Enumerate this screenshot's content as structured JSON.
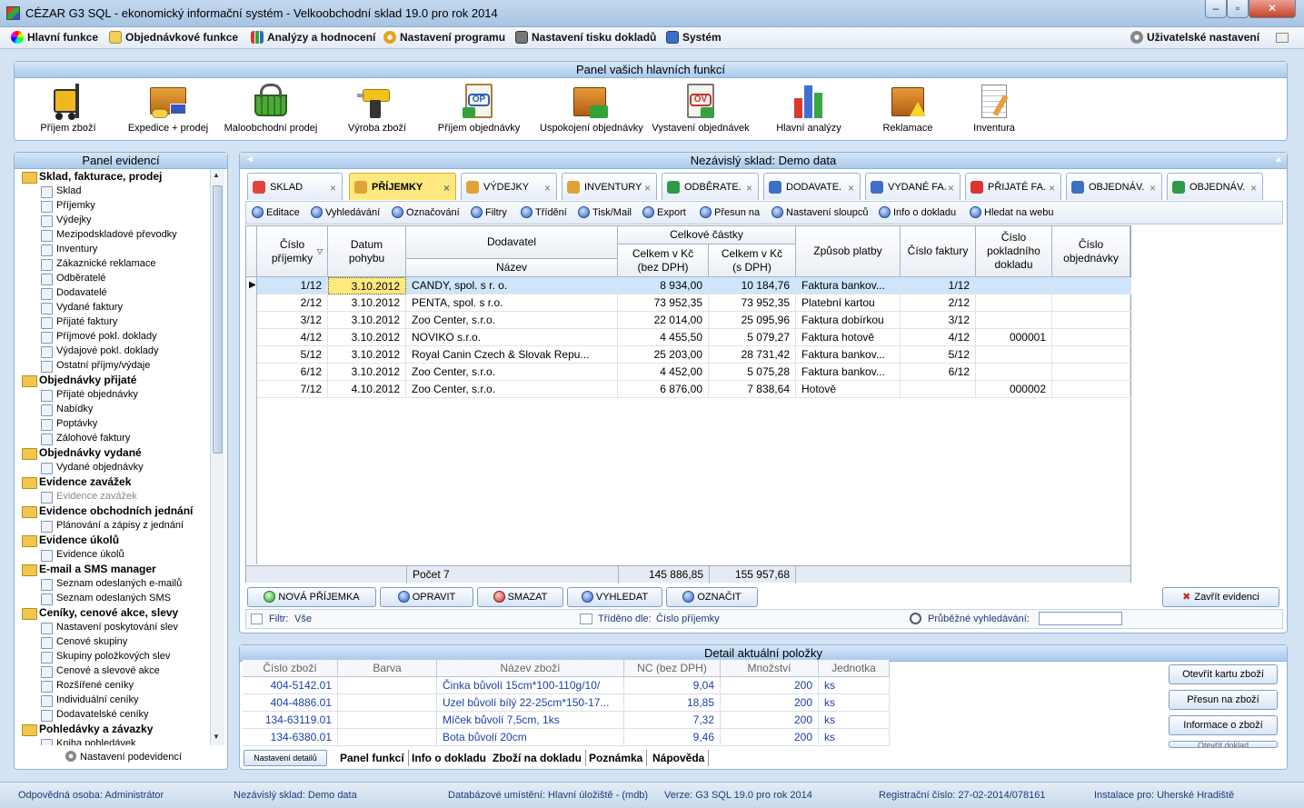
{
  "window": {
    "title": "CÉZAR G3 SQL - ekonomický informační systém - Velkoobchodní sklad 19.0 pro rok 2014",
    "min": "–",
    "max": "▫",
    "close": "✕"
  },
  "menu": {
    "items": [
      "Hlavní funkce",
      "Objednávkové funkce",
      "Analýzy a hodnocení",
      "Nastavení programu",
      "Nastavení tisku dokladů",
      "Systém"
    ],
    "right": "Uživatelské nastavení"
  },
  "main_panel": {
    "title": "Panel vašich hlavních funkcí",
    "functions": [
      "Příjem zboží",
      "Expedice + prodej",
      "Maloobchodní prodej",
      "Výroba zboží",
      "Příjem objednávky",
      "Uspokojení objednávky",
      "Vystavení objednávek",
      "Hlavní analýzy",
      "Reklamace",
      "Inventura"
    ]
  },
  "evid": {
    "title": "Panel evidencí",
    "groups": [
      {
        "label": "Sklad, fakturace, prodej",
        "items": [
          "Sklad",
          "Příjemky",
          "Výdejky",
          "Mezipodskladové převodky",
          "Inventury",
          "Zákaznické reklamace",
          "Odběratelé",
          "Dodavatelé",
          "Vydané faktury",
          "Přijaté faktury",
          "Příjmové pokl. doklady",
          "Výdajové pokl. doklady",
          "Ostatní příjmy/výdaje"
        ]
      },
      {
        "label": "Objednávky přijaté",
        "items": [
          "Přijaté objednávky",
          "Nabídky",
          "Poptávky",
          "Zálohové faktury"
        ]
      },
      {
        "label": "Objednávky vydané",
        "items": [
          "Vydané objednávky"
        ]
      },
      {
        "label": "Evidence zavážek",
        "items": [
          "Evidence zavážek"
        ]
      },
      {
        "label": "Evidence obchodních jednání",
        "items": [
          "Plánování a zápisy z jednání"
        ]
      },
      {
        "label": "Evidence úkolů",
        "items": [
          "Evidence úkolů"
        ]
      },
      {
        "label": "E-mail a SMS manager",
        "items": [
          "Seznam odeslaných e-mailů",
          "Seznam odeslaných SMS"
        ]
      },
      {
        "label": "Ceníky, cenové akce, slevy",
        "items": [
          "Nastavení poskytování slev",
          "Cenové skupiny",
          "Skupiny položkových slev",
          "Cenové a slevové akce",
          "Rozšířené ceníky",
          "Individuální ceníky",
          "Dodavatelské ceníky"
        ]
      },
      {
        "label": "Pohledávky a závazky",
        "items": [
          "Kniha pohledávek"
        ]
      }
    ],
    "footer": "Nastavení podevidencí"
  },
  "sklad": {
    "title": "Nezávislý sklad: Demo data",
    "tabs": [
      "SKLAD",
      "PŘÍJEMKY",
      "VÝDEJKY",
      "INVENTURY",
      "ODBĚRATE.",
      "DODAVATE.",
      "VYDANÉ FA.",
      "PŘIJATÉ FA.",
      "OBJEDNÁV.",
      "OBJEDNÁV."
    ],
    "toolbar": [
      "Editace",
      "Vyhledávání",
      "Označování",
      "Filtry",
      "Třídění",
      "Tisk/Mail",
      "Export",
      "Přesun na",
      "Nastavení sloupců",
      "Info o dokladu",
      "Hledat na webu"
    ],
    "headers": {
      "cislo": "Číslo příjemky",
      "datum": "Datum pohybu",
      "dodavatel": "Dodavatel",
      "nazev": "Název",
      "castky": "Celkové částky",
      "bez": "Celkem v Kč (bez DPH)",
      "s": "Celkem v Kč (s DPH)",
      "zpusob": "Způsob platby",
      "faktura": "Číslo faktury",
      "pokl": "Číslo pokladního dokladu",
      "obj": "Číslo objednávky"
    },
    "rows": [
      {
        "c": "1/12",
        "d": "3.10.2012",
        "n": "CANDY, spol. s r. o.",
        "b": "8 934,00",
        "s": "10 184,76",
        "z": "Faktura bankov...",
        "f": "1/12",
        "p": ""
      },
      {
        "c": "2/12",
        "d": "3.10.2012",
        "n": "PENTA, spol. s r.o.",
        "b": "73 952,35",
        "s": "73 952,35",
        "z": "Platební kartou",
        "f": "2/12",
        "p": ""
      },
      {
        "c": "3/12",
        "d": "3.10.2012",
        "n": "Zoo Center, s.r.o.",
        "b": "22 014,00",
        "s": "25 095,96",
        "z": "Faktura dobírkou",
        "f": "3/12",
        "p": ""
      },
      {
        "c": "4/12",
        "d": "3.10.2012",
        "n": "NOVIKO s.r.o.",
        "b": "4 455,50",
        "s": "5 079,27",
        "z": "Faktura hotově",
        "f": "4/12",
        "p": "000001"
      },
      {
        "c": "5/12",
        "d": "3.10.2012",
        "n": "Royal Canin Czech & Slovak Repu...",
        "b": "25 203,00",
        "s": "28 731,42",
        "z": "Faktura bankov...",
        "f": "5/12",
        "p": ""
      },
      {
        "c": "6/12",
        "d": "3.10.2012",
        "n": "Zoo Center, s.r.o.",
        "b": "4 452,00",
        "s": "5 075,28",
        "z": "Faktura bankov...",
        "f": "6/12",
        "p": ""
      },
      {
        "c": "7/12",
        "d": "4.10.2012",
        "n": "Zoo Center, s.r.o.",
        "b": "6 876,00",
        "s": "7 838,64",
        "z": "Hotově",
        "f": "",
        "p": "000002"
      }
    ],
    "summary": {
      "count": "Počet 7",
      "bez": "145 886,85",
      "s": "155 957,68"
    },
    "buttons": [
      "NOVÁ PŘÍJEMKA",
      "OPRAVIT",
      "SMAZAT",
      "VYHLEDAT",
      "OZNAČIT",
      "Zavřít evidenci"
    ],
    "filter": {
      "label": "Filtr:",
      "value": "Vše",
      "sort_label": "Tříděno dle:",
      "sort_value": "Číslo příjemky",
      "search_label": "Průběžné vyhledávání:"
    }
  },
  "detail": {
    "title": "Detail aktuální položky",
    "headers": [
      "Číslo zboží",
      "Barva",
      "Název zboží",
      "NC (bez DPH)",
      "Množství",
      "Jednotka"
    ],
    "rows": [
      {
        "c": "404-5142.01",
        "b": "",
        "n": "Činka bůvolí 15cm*100-110g/10/",
        "nc": "9,04",
        "m": "200",
        "j": "ks"
      },
      {
        "c": "404-4886.01",
        "b": "",
        "n": "Uzel bůvolí bílý 22-25cm*150-17...",
        "nc": "18,85",
        "m": "200",
        "j": "ks"
      },
      {
        "c": "134-63119.01",
        "b": "",
        "n": "Míček bůvolí 7,5cm, 1ks",
        "nc": "7,32",
        "m": "200",
        "j": "ks"
      },
      {
        "c": "134-6380.01",
        "b": "",
        "n": "Bota bůvolí 20cm",
        "nc": "9,46",
        "m": "200",
        "j": "ks"
      }
    ],
    "actions": [
      "Otevřít kartu zboží",
      "Přesun na zboží",
      "Informace o zboží",
      "Otevřít doklad"
    ],
    "bottom_tabs": [
      "Nastavení detailů",
      "Panel funkcí",
      "Info o dokladu",
      "Zboží na dokladu",
      "Poznámka",
      "Nápověda"
    ]
  },
  "status": [
    "Odpovědná osoba:  Administrátor",
    "Nezávislý sklad:  Demo data",
    "Databázové umístění:  Hlavní úložiště - (mdb)",
    "Verze:  G3 SQL 19.0 pro rok 2014",
    "Registrační číslo:  27-02-2014/078161",
    "Instalace pro:  Uherské Hradiště"
  ]
}
